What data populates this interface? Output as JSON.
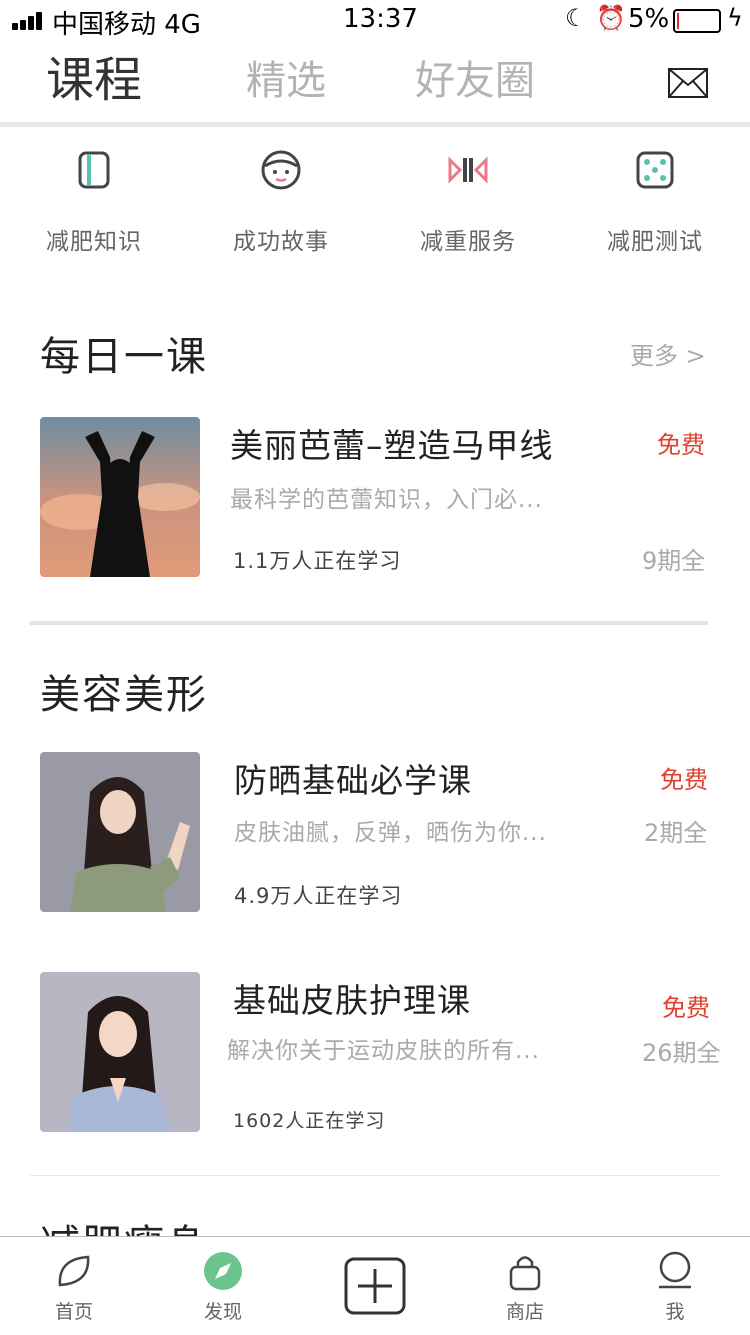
{
  "status_bar": {
    "carrier": "中国移动  4G",
    "time": "13:37",
    "battery": "5%",
    "battery_level_percent": 5,
    "battery_color": "#d9302e"
  },
  "top_tabs": {
    "tabs": [
      {
        "label": "课程",
        "active": true
      },
      {
        "label": "精选",
        "active": false
      },
      {
        "label": "好友圈",
        "active": false
      }
    ],
    "message_icon": "envelope-icon"
  },
  "categories": [
    {
      "label": "减肥知识",
      "icon": "book-icon"
    },
    {
      "label": "成功故事",
      "icon": "face-icon"
    },
    {
      "label": "减重服务",
      "icon": "service-icon"
    },
    {
      "label": "减肥测试",
      "icon": "dice-icon"
    }
  ],
  "daily": {
    "title": "每日一课",
    "more": "更多 >",
    "course": {
      "title": "美丽芭蕾–塑造马甲线",
      "desc": "最科学的芭蕾知识，入门必...",
      "learners": "1.1万人正在学习",
      "price": "免费",
      "episodes": "9期全"
    }
  },
  "beauty": {
    "title": "美容美形",
    "courses": [
      {
        "title": "防晒基础必学课",
        "desc": "皮肤油腻，反弹，晒伤为你...",
        "learners": "4.9万人正在学习",
        "price": "免费",
        "episodes": "2期全"
      },
      {
        "title": "基础皮肤护理课",
        "desc": "解决你关于运动皮肤的所有...",
        "learners": "1602人正在学习",
        "price": "免费",
        "episodes": "26期全"
      }
    ]
  },
  "next_section": {
    "title": "减肥瘦身"
  },
  "bottom_nav": {
    "items": [
      {
        "label": "首页",
        "icon": "leaf-icon"
      },
      {
        "label": "发现",
        "icon": "compass-icon"
      },
      {
        "label": "",
        "icon": "plus-icon"
      },
      {
        "label": "商店",
        "icon": "bag-icon"
      },
      {
        "label": "我",
        "icon": "user-icon"
      }
    ]
  },
  "colors": {
    "accent_green": "#6bc38e",
    "price_red": "#e0402f",
    "icon_teal": "#5bbfb1",
    "icon_pink": "#e87a8a"
  }
}
